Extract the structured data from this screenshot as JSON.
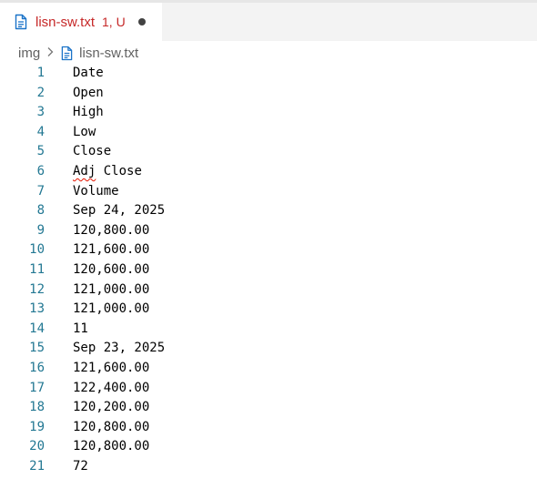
{
  "tab": {
    "filename": "lisn-sw.txt",
    "status": "1, U",
    "icon": "file-icon"
  },
  "breadcrumb": {
    "folder": "img",
    "file": "lisn-sw.txt"
  },
  "lines": [
    {
      "num": "1",
      "text": "Date"
    },
    {
      "num": "2",
      "text": "Open"
    },
    {
      "num": "3",
      "text": "High"
    },
    {
      "num": "4",
      "text": "Low"
    },
    {
      "num": "5",
      "text": "Close"
    },
    {
      "num": "6",
      "text": "Adj Close",
      "squiggle": "Adj",
      "rest": " Close"
    },
    {
      "num": "7",
      "text": "Volume"
    },
    {
      "num": "8",
      "text": "Sep 24, 2025"
    },
    {
      "num": "9",
      "text": "120,800.00"
    },
    {
      "num": "10",
      "text": "121,600.00"
    },
    {
      "num": "11",
      "text": "120,600.00"
    },
    {
      "num": "12",
      "text": "121,000.00"
    },
    {
      "num": "13",
      "text": "121,000.00"
    },
    {
      "num": "14",
      "text": "11"
    },
    {
      "num": "15",
      "text": "Sep 23, 2025"
    },
    {
      "num": "16",
      "text": "121,600.00"
    },
    {
      "num": "17",
      "text": "122,400.00"
    },
    {
      "num": "18",
      "text": "120,200.00"
    },
    {
      "num": "19",
      "text": "120,800.00"
    },
    {
      "num": "20",
      "text": "120,800.00"
    },
    {
      "num": "21",
      "text": "72"
    }
  ],
  "colors": {
    "tab_text": "#c62828",
    "line_number": "#237893",
    "icon": "#1a73c8",
    "error_squiggle": "#e51400"
  }
}
